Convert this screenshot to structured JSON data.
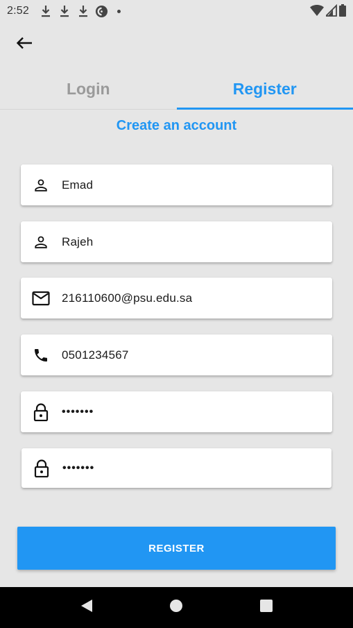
{
  "status_bar": {
    "time": "2:52",
    "icons": [
      "download-icon",
      "download-icon",
      "download-icon",
      "pocket-casts-icon",
      "dot-icon",
      "wifi-icon",
      "signal-icon",
      "battery-icon"
    ]
  },
  "app_bar": {
    "back_icon": "arrow-back-icon"
  },
  "tabs": [
    {
      "label": "Login",
      "active": false
    },
    {
      "label": "Register",
      "active": true
    }
  ],
  "subtitle": "Create an account",
  "form": {
    "first_name": {
      "icon": "person-icon",
      "value": "Emad"
    },
    "last_name": {
      "icon": "person-icon",
      "value": "Rajeh"
    },
    "email": {
      "icon": "mail-icon",
      "value": "216110600@psu.edu.sa"
    },
    "phone": {
      "icon": "phone-icon",
      "value": "0501234567"
    },
    "password": {
      "icon": "lock-icon",
      "value": "•••••••"
    },
    "confirm_password": {
      "icon": "lock-icon",
      "value": "•••••••"
    }
  },
  "register_button": {
    "label": "REGISTER"
  },
  "colors": {
    "accent": "#2196f3",
    "background": "#e6e6e6",
    "inactive_tab": "#9a9a9a"
  },
  "nav_bar": {
    "icons": [
      "back-triangle-icon",
      "home-circle-icon",
      "recents-square-icon"
    ]
  }
}
